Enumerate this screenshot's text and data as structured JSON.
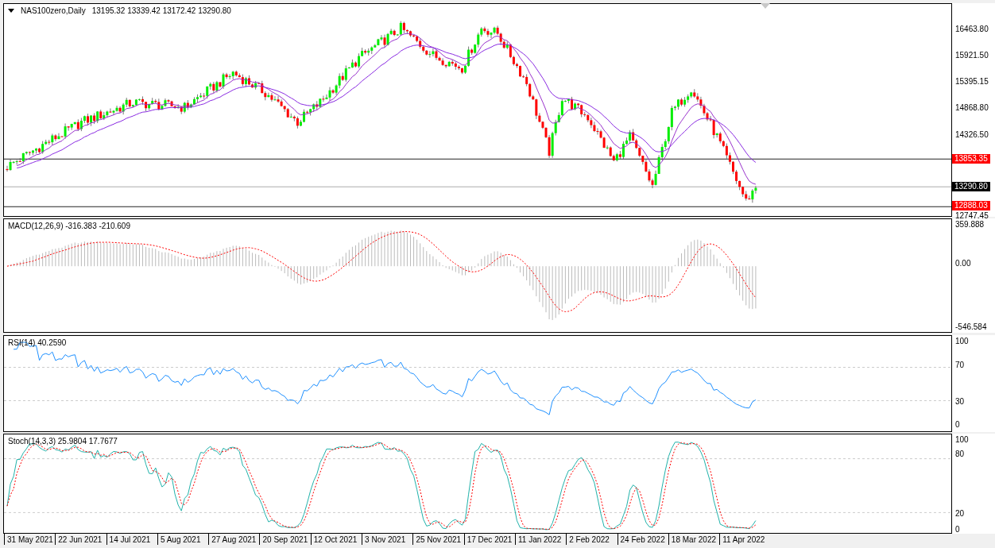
{
  "chart": {
    "symbol": "NAS100zero,Daily",
    "ohlc": "13195.32 13339.42 13172.42 13290.80"
  },
  "price_axis": [
    "16463.80",
    "15921.50",
    "15395.15",
    "14868.80",
    "14326.50",
    "12747.45"
  ],
  "price_tags": [
    {
      "value": "13853.35",
      "kind": "level"
    },
    {
      "value": "13290.80",
      "kind": "current"
    },
    {
      "value": "12888.03",
      "kind": "level"
    }
  ],
  "indicators": [
    {
      "kind": "macd",
      "label": "MACD(12,26,9) -316.383 -210.609",
      "axis": [
        "359.888",
        "0.00",
        "-546.584"
      ]
    },
    {
      "kind": "rsi",
      "label": "RSI(14) 40.2590",
      "axis": [
        "100",
        "70",
        "30",
        "0"
      ]
    },
    {
      "kind": "stoch",
      "label": "Stoch(14,3,3) 25.9804 17.7677",
      "axis": [
        "100",
        "80",
        "20",
        "0"
      ]
    }
  ],
  "dates": [
    "31 May 2021",
    "22 Jun 2021",
    "14 Jul 2021",
    "5 Aug 2021",
    "27 Aug 2021",
    "20 Sep 2021",
    "12 Oct 2021",
    "3 Nov 2021",
    "25 Nov 2021",
    "17 Dec 2021",
    "11 Jan 2022",
    "2 Feb 2022",
    "24 Feb 2022",
    "18 Mar 2022",
    "11 Apr 2022"
  ]
}
